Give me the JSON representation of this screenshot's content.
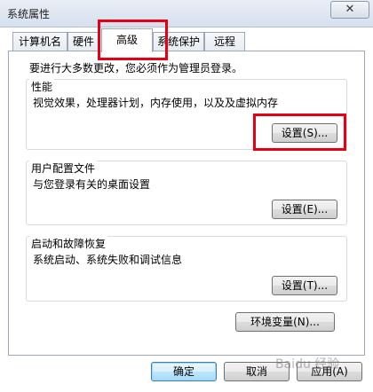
{
  "window": {
    "title": "系统属性",
    "close_glyph": "✕"
  },
  "tabs": [
    {
      "label": "计算机名",
      "active": false
    },
    {
      "label": "硬件",
      "active": false
    },
    {
      "label": "高级",
      "active": true
    },
    {
      "label": "系统保护",
      "active": false
    },
    {
      "label": "远程",
      "active": false
    }
  ],
  "admin_note": "要进行大多数更改，您必须作为管理员登录。",
  "performance": {
    "title": "性能",
    "description": "视觉效果，处理器计划，内存使用，以及及虚拟内存",
    "button": "设置(S)..."
  },
  "user_profiles": {
    "title": "用户配置文件",
    "description": "与您登录有关的桌面设置",
    "button": "设置(E)..."
  },
  "startup_recovery": {
    "title": "启动和故障恢复",
    "description": "系统启动、系统失败和调试信息",
    "button": "设置(T)..."
  },
  "env_vars_button": "环境变量(N)...",
  "footer": {
    "ok": "确定",
    "cancel": "取消",
    "apply": "应用(A)"
  },
  "watermark": "Baidu 经验",
  "highlight_color": "#e60012"
}
